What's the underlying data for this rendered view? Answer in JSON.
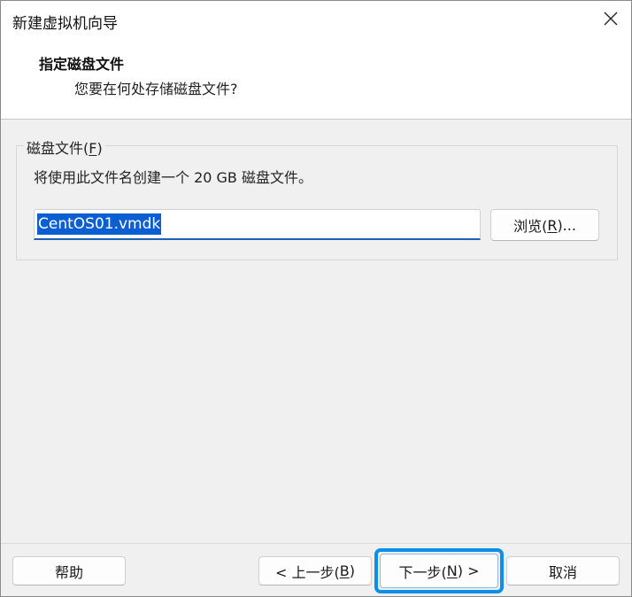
{
  "window": {
    "title": "新建虚拟机向导",
    "close_glyph": "✕"
  },
  "header": {
    "title": "指定磁盘文件",
    "subtitle": "您要在何处存储磁盘文件?"
  },
  "disk_file_group": {
    "legend_text": "磁盘文件(",
    "legend_mnemonic": "F",
    "legend_close": ")",
    "description": "将使用此文件名创建一个 20 GB 磁盘文件。",
    "filename_value": "CentOS01.vmdk",
    "browse_text": "浏览(",
    "browse_mnemonic": "R",
    "browse_close": ")..."
  },
  "footer": {
    "help_label": "帮助",
    "back_text": "< 上一步(",
    "back_mnemonic": "B",
    "back_close": ")",
    "next_text": "下一步(",
    "next_mnemonic": "N",
    "next_close": ") >",
    "cancel_label": "取消"
  },
  "colors": {
    "selection": "#0b5fd3",
    "focus_ring": "#0e8fe8",
    "input_underline": "#1f5fb4"
  }
}
